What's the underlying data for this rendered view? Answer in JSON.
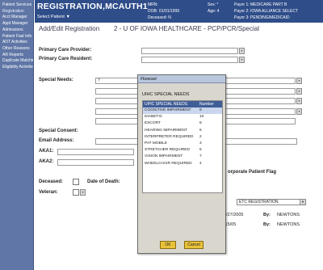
{
  "sidebar": {
    "items": [
      {
        "label": "Patient Services"
      },
      {
        "label": "Registration"
      },
      {
        "label": "Acct Manager"
      },
      {
        "label": "Appt Manager"
      },
      {
        "label": "Admissions"
      },
      {
        "label": "Patient Fast Info"
      },
      {
        "label": "ADT Activities"
      },
      {
        "label": "Other Reasons"
      },
      {
        "label": "AR Reports"
      },
      {
        "label": "Duplicate Matching"
      },
      {
        "label": "Eligibility Activities"
      }
    ]
  },
  "banner": {
    "patient_name": "REGISTRATION,MCAUTH1",
    "select_patient": "Select Patient ▼",
    "mrn": "MRN:",
    "mrn_value": "",
    "dob": "DOB:",
    "dob_value": "01/01/1999",
    "deceased": "Deceased: N",
    "sex": "Sex: *",
    "age": "Age: 4",
    "payor1": "Payor 1: MEDICARE PART B",
    "payor2": "Payor 2: IOWA ALLIANCE SELECT",
    "payor3": "Payor 3: PENDING/MEDICAID"
  },
  "form": {
    "title": "Add/Edit Registration",
    "subtitle": "2 - U OF IOWA HEALTHCARE - PCP/PCR/Special",
    "primary_provider_label": "Primary Care Provider:",
    "primary_resident_label": "Primary Care Resident:",
    "special_needs_label": "Special Needs:",
    "special_needs_value": "?",
    "special_consent_label": "Special Consent:",
    "email_label": "Email Address:",
    "aka1_label": "AKA1:",
    "aka2_label": "AKA2:",
    "corporate_flag_label": "orporate Patient Flag",
    "deceased_label": "Deceased:",
    "date_of_death_label": "Date of Death:",
    "veteran_label": "Veteran:",
    "registration_type_value": "ETC REGISTRATION",
    "created_date": "7/27/2005",
    "created_by_label": "By:",
    "created_by": "NEWTONS",
    "updated_date": "/15/05",
    "updated_by_label": "By:",
    "updated_by": "NEWTONS"
  },
  "popup": {
    "title": "Flowcast",
    "list_title": "UIHC SPECIAL NEEDS",
    "headers": [
      "UIHC SPECIAL NEEDS",
      "Number"
    ],
    "rows": [
      {
        "name": "COGNITIVE IMPAIRMENT",
        "number": "9"
      },
      {
        "name": "DIABETIC",
        "number": "10"
      },
      {
        "name": "ESCORT",
        "number": "8"
      },
      {
        "name": "HEARING IMPAIRMENT",
        "number": "6"
      },
      {
        "name": "INTERPRETER REQUIRED",
        "number": "2"
      },
      {
        "name": "PAT MOBILE",
        "number": "3"
      },
      {
        "name": "STRETCHER REQUIRED",
        "number": "5"
      },
      {
        "name": "VISION IMPAIRMENT",
        "number": "7"
      },
      {
        "name": "WHEELCHAIR REQUIRED",
        "number": "4"
      }
    ],
    "ok_label": "OK",
    "cancel_label": "Cancel"
  },
  "colors": {
    "sidebar": "#5f76a6",
    "banner": "#2f4d89",
    "popup_header": "#3f5d96",
    "button": "#e8c23a"
  }
}
